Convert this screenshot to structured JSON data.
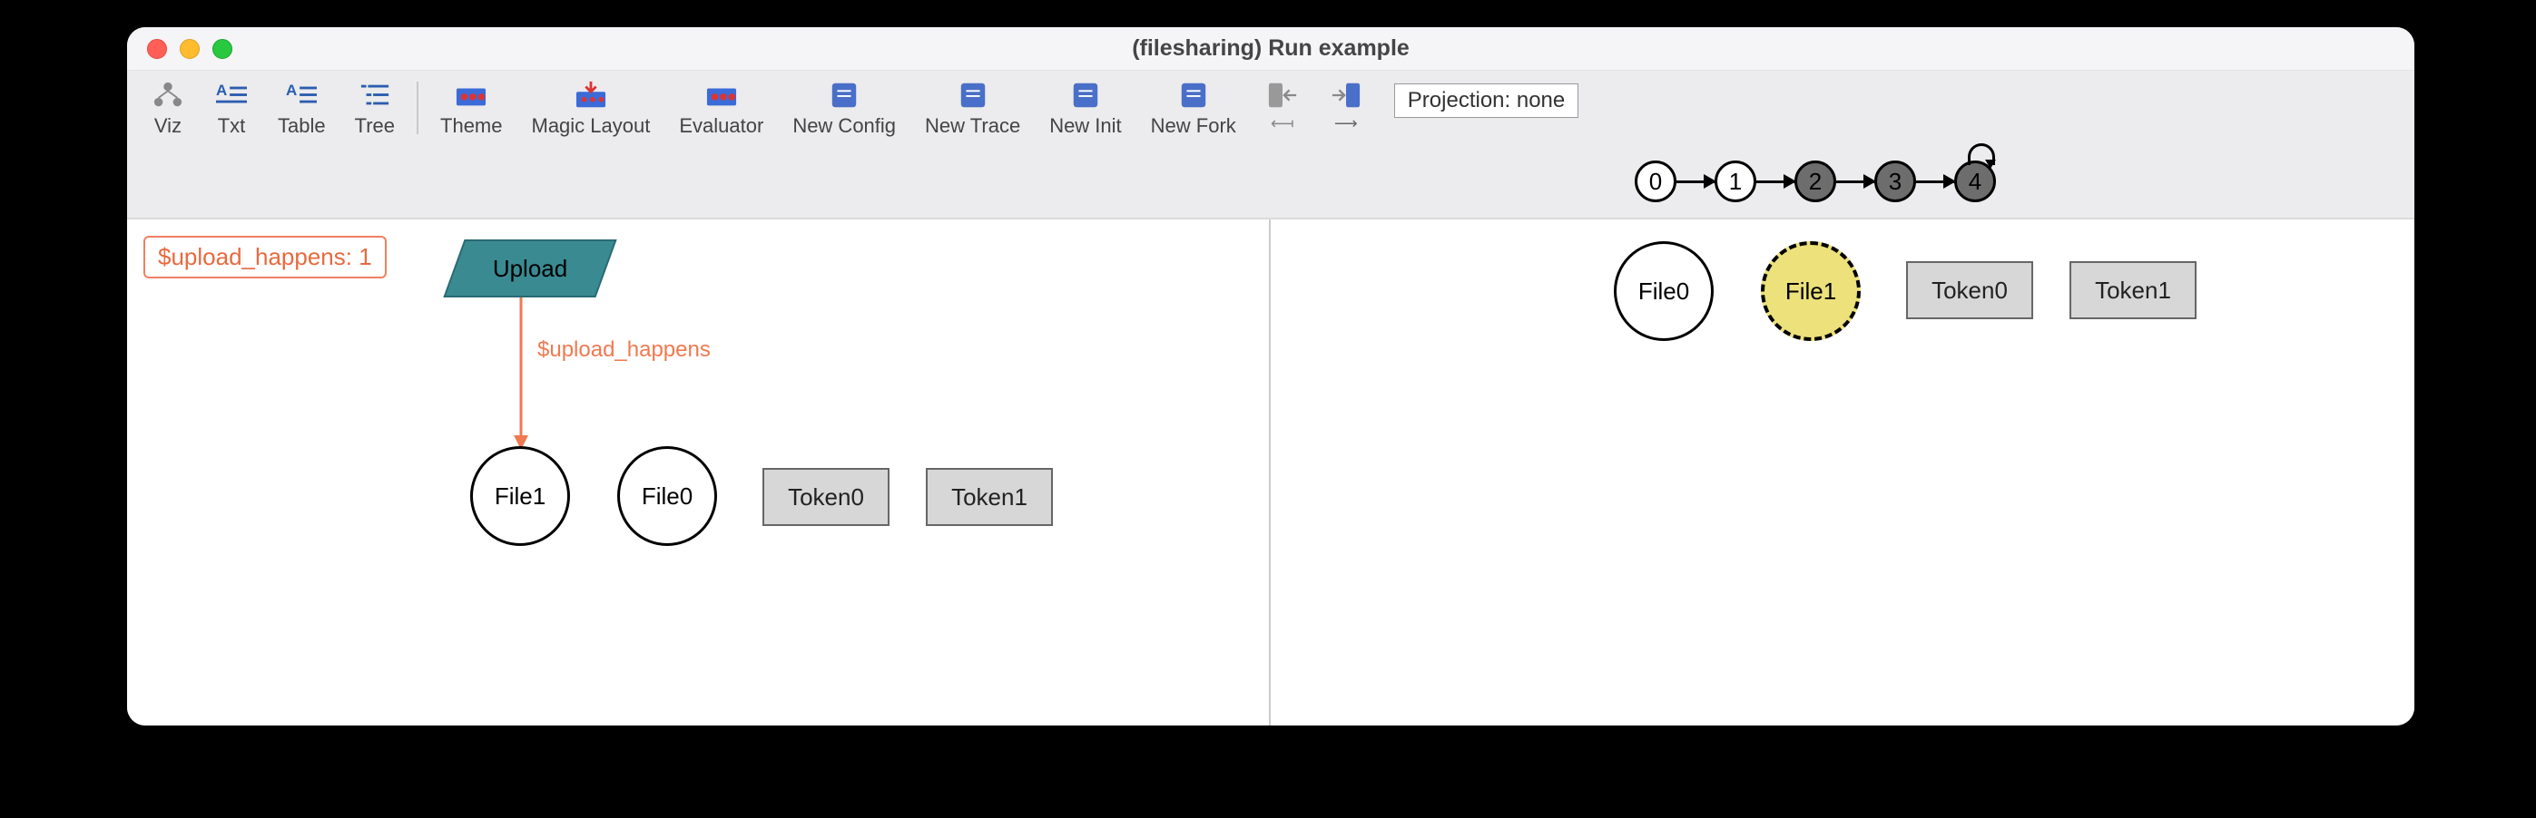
{
  "window": {
    "title": "(filesharing) Run example"
  },
  "toolbar": {
    "viz": "Viz",
    "txt": "Txt",
    "table": "Table",
    "tree": "Tree",
    "theme": "Theme",
    "magic_layout": "Magic Layout",
    "evaluator": "Evaluator",
    "new_config": "New Config",
    "new_trace": "New Trace",
    "new_init": "New Init",
    "new_fork": "New Fork",
    "projection_label": "Projection: none"
  },
  "timeline": {
    "states": [
      "0",
      "1",
      "2",
      "3",
      "4"
    ],
    "current": 4,
    "dark_from": 2
  },
  "left_pane": {
    "badge": "$upload_happens: 1",
    "upload_label": "Upload",
    "edge_label": "$upload_happens",
    "file1": "File1",
    "file0": "File0",
    "token0": "Token0",
    "token1": "Token1"
  },
  "right_pane": {
    "file0": "File0",
    "file1": "File1",
    "token0": "Token0",
    "token1": "Token1"
  }
}
